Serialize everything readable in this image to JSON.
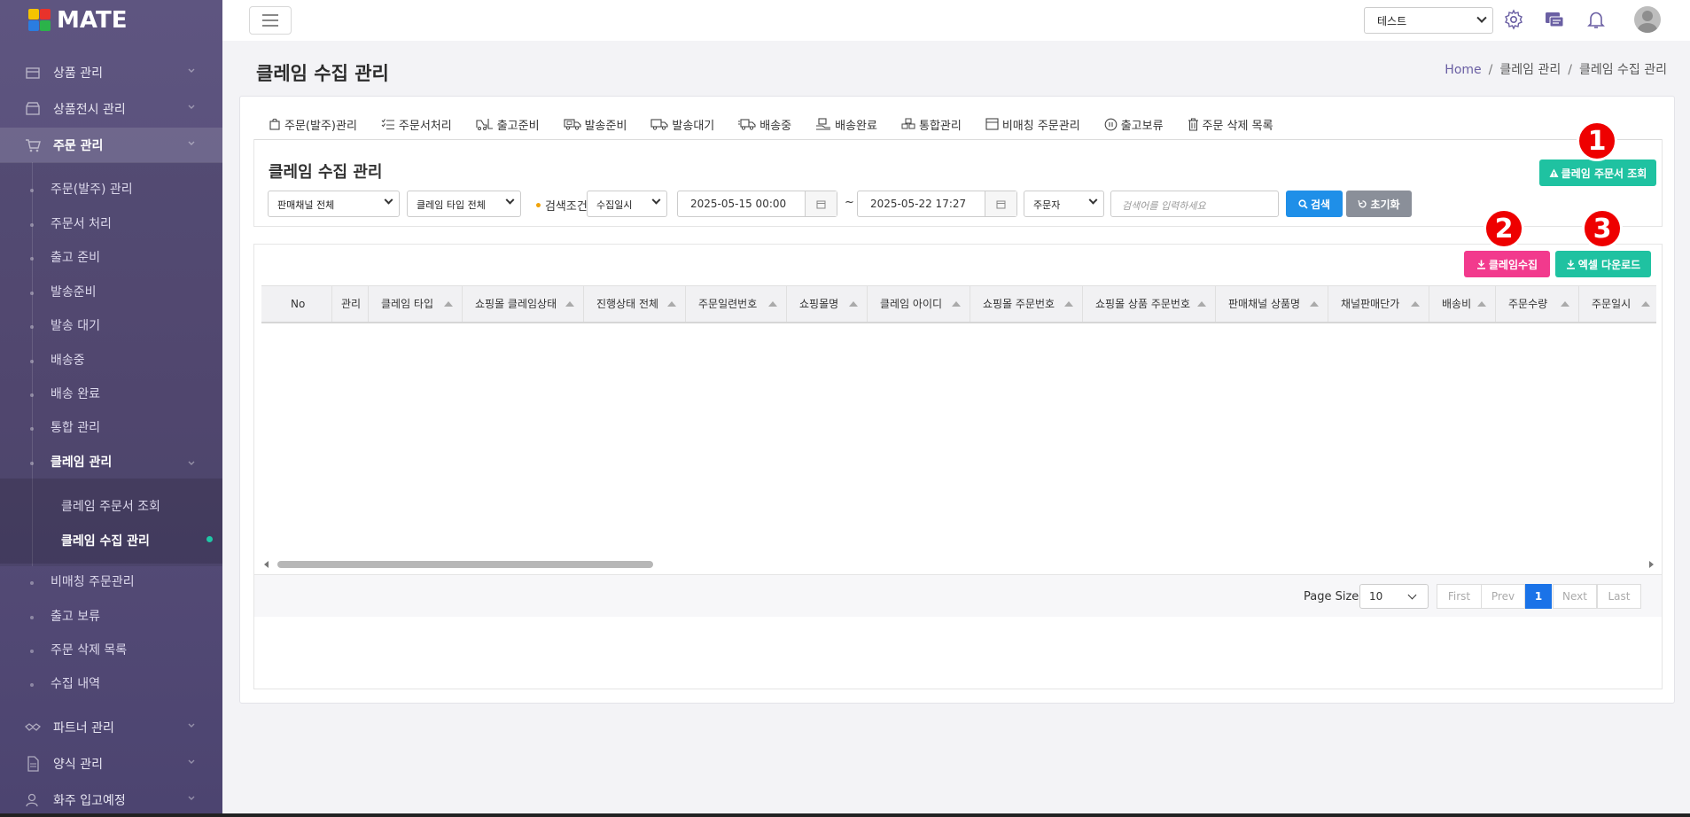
{
  "app": {
    "logo_text": "MATE"
  },
  "sidebar": {
    "top_items": [
      {
        "label": "상품 관리"
      },
      {
        "label": "상품전시 관리"
      },
      {
        "label": "주문 관리"
      }
    ],
    "order_sub": [
      {
        "label": "주문(발주) 관리"
      },
      {
        "label": "주문서 처리"
      },
      {
        "label": "출고 준비"
      },
      {
        "label": "발송준비"
      },
      {
        "label": "발송 대기"
      },
      {
        "label": "배송중"
      },
      {
        "label": "배송 완료"
      },
      {
        "label": "통합 관리"
      },
      {
        "label": "클레임 관리"
      }
    ],
    "claim_sub": [
      {
        "label": "클레임 주문서 조회"
      },
      {
        "label": "클레임 수집 관리"
      }
    ],
    "order_sub_after": [
      {
        "label": "비매칭 주문관리"
      },
      {
        "label": "출고 보류"
      },
      {
        "label": "주문 삭제 목록"
      },
      {
        "label": "수집 내역"
      }
    ],
    "bottom_items": [
      {
        "label": "파트너 관리"
      },
      {
        "label": "양식 관리"
      },
      {
        "label": "화주 입고예정"
      }
    ]
  },
  "topbar": {
    "company_select": "테스트"
  },
  "page": {
    "title": "클레임 수집 관리",
    "breadcrumb": [
      "Home",
      "클레임 관리",
      "클레임 수집 관리"
    ]
  },
  "tabs": [
    {
      "label": "주문(발주)관리",
      "icon": "bag-icon"
    },
    {
      "label": "주문서처리",
      "icon": "checklist-icon"
    },
    {
      "label": "출고준비",
      "icon": "forklift-icon"
    },
    {
      "label": "발송준비",
      "icon": "truck-box-icon"
    },
    {
      "label": "발송대기",
      "icon": "truck-icon"
    },
    {
      "label": "배송중",
      "icon": "truck-fast-icon"
    },
    {
      "label": "배송완료",
      "icon": "delivered-icon"
    },
    {
      "label": "통합관리",
      "icon": "boxes-icon"
    },
    {
      "label": "비매칭 주문관리",
      "icon": "box-icon"
    },
    {
      "label": "출고보류",
      "icon": "pause-icon"
    },
    {
      "label": "주문 삭제 목록",
      "icon": "trash-icon"
    }
  ],
  "search": {
    "panel_title": "클레임 수집 관리",
    "channel_select": "판매채널 전체",
    "claim_type_select": "클레임 타입 전체",
    "condition_label": "검색조건",
    "date_type_select": "수집일시",
    "date_from": "2025-05-15 00:00",
    "tilde": "~",
    "date_to": "2025-05-22 17:27",
    "field_select": "주문자",
    "keyword_placeholder": "검색어를 입력하세요",
    "search_button": "검색",
    "reset_button": "초기화",
    "claim_order_lookup_button": "클레임 주문서 조회"
  },
  "actions": {
    "claim_collect_button": "클레임수집",
    "excel_download_button": "엑셀 다운로드"
  },
  "badges": [
    "1",
    "2",
    "3"
  ],
  "table": {
    "columns": [
      "No",
      "관리",
      "클레임 타입",
      "쇼핑몰 클레임상태",
      "진행상태 전체",
      "주문일련번호",
      "쇼핑몰명",
      "클레임 아이디",
      "쇼핑몰 주문번호",
      "쇼핑몰 상품 주문번호",
      "판매채널 상품명",
      "채널판매단가",
      "배송비",
      "주문수량",
      "주문일시"
    ],
    "rows": []
  },
  "pagination": {
    "size_label": "Page Size",
    "page_size": "10",
    "first": "First",
    "prev": "Prev",
    "current": "1",
    "next": "Next",
    "last": "Last"
  },
  "colors": {
    "sidebar": "#574d78",
    "teal": "#1fc2a1",
    "pink": "#f23a8d",
    "blue": "#1f8fe8",
    "badge_red": "#e00000"
  }
}
